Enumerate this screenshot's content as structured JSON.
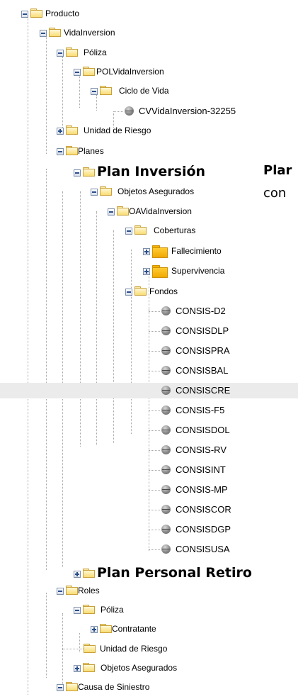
{
  "tree": {
    "producto": "Producto",
    "vida_inversion": "VidaInversion",
    "poliza": "Póliza",
    "pol_vida_inversion": "POLVidaInversion",
    "ciclo_de_vida": "Ciclo de Vida",
    "cv_vida_inversion": "CVVidaInversion-32255",
    "unidad_de_riesgo": "Unidad de Riesgo",
    "planes": "Planes",
    "plan_inversion": "Plan Inversión",
    "objetos_asegurados": "Objetos Asegurados",
    "oa_vida_inversion": "OAVidaInversion",
    "coberturas": "Coberturas",
    "fallecimiento": "Fallecimiento",
    "supervivencia": "Supervivencia",
    "fondos": "Fondos",
    "fondos_items": [
      "CONSIS-D2",
      "CONSISDLP",
      "CONSISPRA",
      "CONSISBAL",
      "CONSISCRE",
      "CONSIS-F5",
      "CONSISDOL",
      "CONSIS-RV",
      "CONSISINT",
      "CONSIS-MP",
      "CONSISCOR",
      "CONSISDGP",
      "CONSISUSA"
    ],
    "plan_personal_retiro": "Plan Personal Retiro",
    "roles": "Roles",
    "roles_poliza": "Póliza",
    "contratante": "Contratante",
    "roles_unidad_de_riesgo": "Unidad de Riesgo",
    "roles_objetos_asegurados": "Objetos Asegurados",
    "causa_de_siniestro": "Causa de Siniestro"
  },
  "side_note": {
    "line1": "Plar",
    "line2": "con"
  },
  "selected_item": "CONSISCRE"
}
